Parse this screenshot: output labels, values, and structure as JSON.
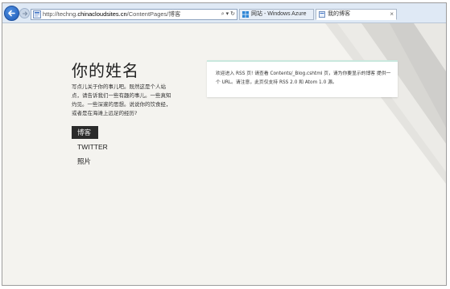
{
  "browser": {
    "url_prefix": "http://techng.",
    "url_host": "chinacloudsites.cn",
    "url_path": "/ContentPages/博客",
    "tabs": [
      {
        "label": "网站 - Windows Azure"
      },
      {
        "label": "我的博客"
      }
    ],
    "tab_close": "×",
    "search_glyph": "⌕",
    "dropdown_glyph": "▾",
    "refresh_glyph": "↻",
    "back_icon": "back-arrow-icon",
    "forward_icon": "forward-arrow-icon"
  },
  "page": {
    "title": "你的姓名",
    "description": "写点儿关于你的事儿吧。既然这是个人站点，请告诉我们一些有趣的事儿。一些真知灼见。一些深邃的思想。说说你的饮食经，或者是在海滩上远足的经历?",
    "nav": [
      {
        "label": "博客",
        "active": true
      },
      {
        "label": "TWITTER",
        "active": false
      },
      {
        "label": "照片",
        "active": false
      }
    ],
    "notice": "欢迎进入 RSS 页! 请查看 Contents/_Blog.cshtml 页，请为你要显示的博客 提供一个 URL。请注意，此页仅支持 RSS 2.0 和 Atom 1.0 源。"
  },
  "colors": {
    "page_bg": "#f4f3ef",
    "nav_active_bg": "#2b2b2b",
    "notice_accent": "#c9e8de",
    "chrome_bg": "#dfe9f5",
    "back_button": "#1e5bb8"
  }
}
